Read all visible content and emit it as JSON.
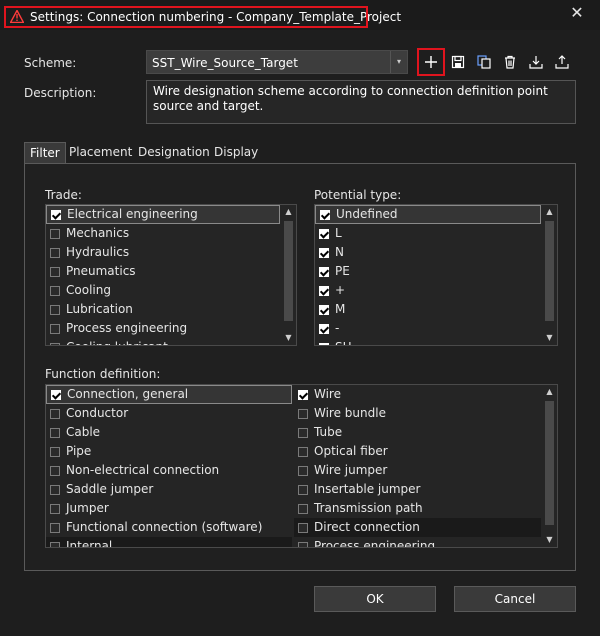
{
  "window": {
    "title": "Settings: Connection numbering - Company_Template_Project",
    "close_label": "✕"
  },
  "scheme": {
    "label": "Scheme:",
    "value": "SST_Wire_Source_Target",
    "dropdown_arrow": "▾"
  },
  "description": {
    "label": "Description:",
    "value": "Wire designation scheme according to connection definition point source and target."
  },
  "toolbar_icons": [
    "add-icon",
    "save-icon",
    "copy-icon",
    "delete-icon",
    "import-icon",
    "export-icon"
  ],
  "tabs": [
    {
      "label": "Filter"
    },
    {
      "label": "Placement"
    },
    {
      "label": "Designation"
    },
    {
      "label": "Display"
    }
  ],
  "trade": {
    "label": "Trade:",
    "items": [
      {
        "label": "Electrical engineering",
        "checked": true
      },
      {
        "label": "Mechanics",
        "checked": false
      },
      {
        "label": "Hydraulics",
        "checked": false
      },
      {
        "label": "Pneumatics",
        "checked": false
      },
      {
        "label": "Cooling",
        "checked": false
      },
      {
        "label": "Lubrication",
        "checked": false
      },
      {
        "label": "Process engineering",
        "checked": false
      },
      {
        "label": "Cooling lubricant",
        "checked": false
      }
    ]
  },
  "potential": {
    "label": "Potential type:",
    "items": [
      {
        "label": "Undefined",
        "checked": true
      },
      {
        "label": "L",
        "checked": true
      },
      {
        "label": "N",
        "checked": true
      },
      {
        "label": "PE",
        "checked": true
      },
      {
        "label": "+",
        "checked": true
      },
      {
        "label": "M",
        "checked": true
      },
      {
        "label": "-",
        "checked": true
      },
      {
        "label": "SH",
        "checked": true
      }
    ]
  },
  "function_definition": {
    "label": "Function definition:",
    "left": [
      {
        "label": "Connection, general",
        "checked": true
      },
      {
        "label": "Conductor",
        "checked": false
      },
      {
        "label": "Cable",
        "checked": false
      },
      {
        "label": "Pipe",
        "checked": false
      },
      {
        "label": "Non-electrical connection",
        "checked": false
      },
      {
        "label": "Saddle jumper",
        "checked": false
      },
      {
        "label": "Jumper",
        "checked": false
      },
      {
        "label": "Functional connection (software)",
        "checked": false
      },
      {
        "label": "Internal",
        "checked": false
      }
    ],
    "right": [
      {
        "label": "Wire",
        "checked": true
      },
      {
        "label": "Wire bundle",
        "checked": false
      },
      {
        "label": "Tube",
        "checked": false
      },
      {
        "label": "Optical fiber",
        "checked": false
      },
      {
        "label": "Wire jumper",
        "checked": false
      },
      {
        "label": "Insertable jumper",
        "checked": false
      },
      {
        "label": "Transmission path",
        "checked": false
      },
      {
        "label": "Direct connection",
        "checked": false
      },
      {
        "label": "Process engineering",
        "checked": false
      }
    ]
  },
  "buttons": {
    "ok": "OK",
    "cancel": "Cancel"
  },
  "colors": {
    "highlight": "#e0141e",
    "background": "#1e1e1e"
  }
}
